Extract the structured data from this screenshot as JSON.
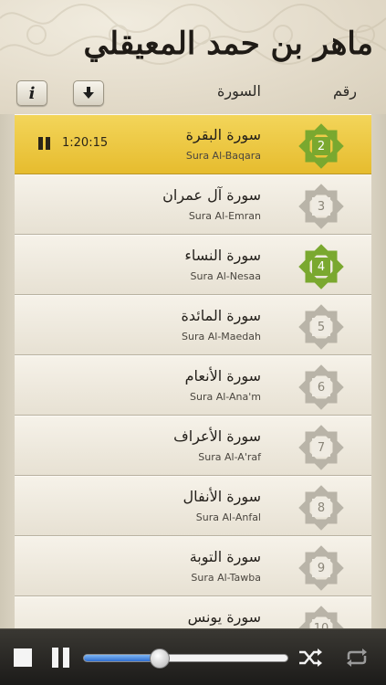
{
  "header": {
    "calligraphy_title": "ماهر بن حمد المعيقلي",
    "info_label": "i",
    "download_icon": "download-arrow-icon",
    "col_sura": "السورة",
    "col_number": "رقم"
  },
  "colors": {
    "active_row": "#e9c23a",
    "badge_green": "#7aa82f",
    "badge_gray": "#b9b4a8",
    "slider_fill": "#3b7fdc"
  },
  "suras": [
    {
      "number": "2",
      "arabic": "سورة البقرة",
      "english": "Sura Al-Baqara",
      "active": true,
      "downloaded": true,
      "time": "1:20:15"
    },
    {
      "number": "3",
      "arabic": "سورة آل عمران",
      "english": "Sura Al-Emran",
      "active": false,
      "downloaded": false,
      "time": ""
    },
    {
      "number": "4",
      "arabic": "سورة النساء",
      "english": "Sura Al-Nesaa",
      "active": false,
      "downloaded": true,
      "time": ""
    },
    {
      "number": "5",
      "arabic": "سورة المائدة",
      "english": "Sura Al-Maedah",
      "active": false,
      "downloaded": false,
      "time": ""
    },
    {
      "number": "6",
      "arabic": "سورة الأنعام",
      "english": "Sura Al-Ana'm",
      "active": false,
      "downloaded": false,
      "time": ""
    },
    {
      "number": "7",
      "arabic": "سورة الأعراف",
      "english": "Sura Al-A'raf",
      "active": false,
      "downloaded": false,
      "time": ""
    },
    {
      "number": "8",
      "arabic": "سورة الأنفال",
      "english": "Sura Al-Anfal",
      "active": false,
      "downloaded": false,
      "time": ""
    },
    {
      "number": "9",
      "arabic": "سورة التوبة",
      "english": "Sura Al-Tawba",
      "active": false,
      "downloaded": false,
      "time": ""
    },
    {
      "number": "10",
      "arabic": "سورة يونس",
      "english": "",
      "active": false,
      "downloaded": false,
      "time": ""
    }
  ],
  "player": {
    "stop_icon": "stop-icon",
    "pause_icon": "pause-icon",
    "progress": 0.37,
    "shuffle_icon": "shuffle-icon",
    "repeat_icon": "repeat-icon"
  }
}
